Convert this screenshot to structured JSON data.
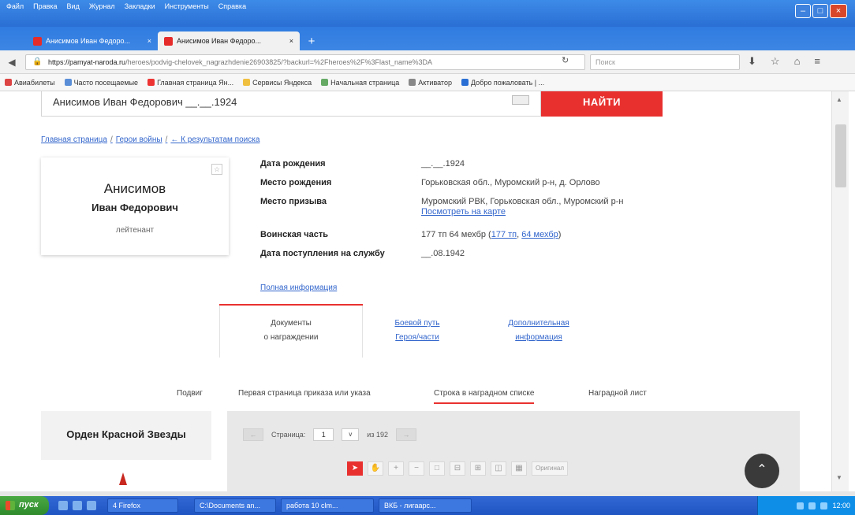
{
  "window": {
    "menu": [
      "Файл",
      "Правка",
      "Вид",
      "Журнал",
      "Закладки",
      "Инструменты",
      "Справка"
    ],
    "min": "–",
    "max": "□",
    "close": "×"
  },
  "tabs": [
    {
      "title": "Анисимов Иван Федоро...",
      "active": false
    },
    {
      "title": "Анисимов Иван Федоро...",
      "active": true
    }
  ],
  "newtab": "+",
  "nav": {
    "url_host": "https://pamyat-naroda.ru",
    "url_path": "/heroes/podvig-chelovek_nagrazhdenie26903825/?backurl=%2Fheroes%2F%3Flast_name%3DA",
    "search_placeholder": "Поиск"
  },
  "bookmarks": [
    "Авиабилеты",
    "Часто посещаемые",
    "Главная страница Ян...",
    "Сервисы Яндекса",
    "Начальная страница",
    "Активатор",
    "Добро пожаловать | ..."
  ],
  "page": {
    "search_value": "Анисимов Иван Федорович __.__.1924",
    "find_label": "НАЙТИ",
    "breadcrumb": [
      "Главная страница",
      "Герои войны",
      "← К результатам поиска"
    ],
    "breadcrumb_sep": "/",
    "fav_icon": "☆",
    "hero": {
      "surname": "Анисимов",
      "name": "Иван Федорович",
      "rank": "лейтенант"
    },
    "info": [
      {
        "label": "Дата рождения",
        "value": "__.__.1924"
      },
      {
        "label": "Место рождения",
        "value": "Горьковская обл., Муромский р-н, д. Орлово"
      },
      {
        "label": "Место призыва",
        "value": "Муромский РВК, Горьковская обл., Муромский р-н",
        "link": "Посмотреть на карте"
      },
      {
        "label": "Воинская часть",
        "value": "177 тп 64 мехбр (",
        "link1": "177 тп",
        "mid": ", ",
        "link2": "64 мехбр",
        "end": ")"
      },
      {
        "label": "Дата поступления на службу",
        "value": "__.08.1942"
      }
    ],
    "full_info": "Полная информация",
    "section_tabs": {
      "active": [
        "Документы",
        "о награждении"
      ],
      "battle": [
        "Боевой путь",
        "Героя/части"
      ],
      "extra": [
        "Дополнительная",
        "информация"
      ]
    },
    "subtabs": [
      "Подвиг",
      "Первая страница приказа или указа",
      "Строка в наградном списке",
      "Наградной лист"
    ],
    "award": "Орден Красной Звезды",
    "viewer": {
      "page_label": "Страница:",
      "page": "1",
      "of": "из 192",
      "prev": "←",
      "next": "→",
      "dropdown": "∨",
      "original": "Оригинал"
    },
    "scroll_top": "⌃"
  },
  "taskbar": {
    "start": "пуск",
    "items": [
      "4 Firefox",
      "C:\\Documents an...",
      "работа 10 clm...",
      "ВКБ - лигаарс..."
    ],
    "time": "12:00"
  }
}
